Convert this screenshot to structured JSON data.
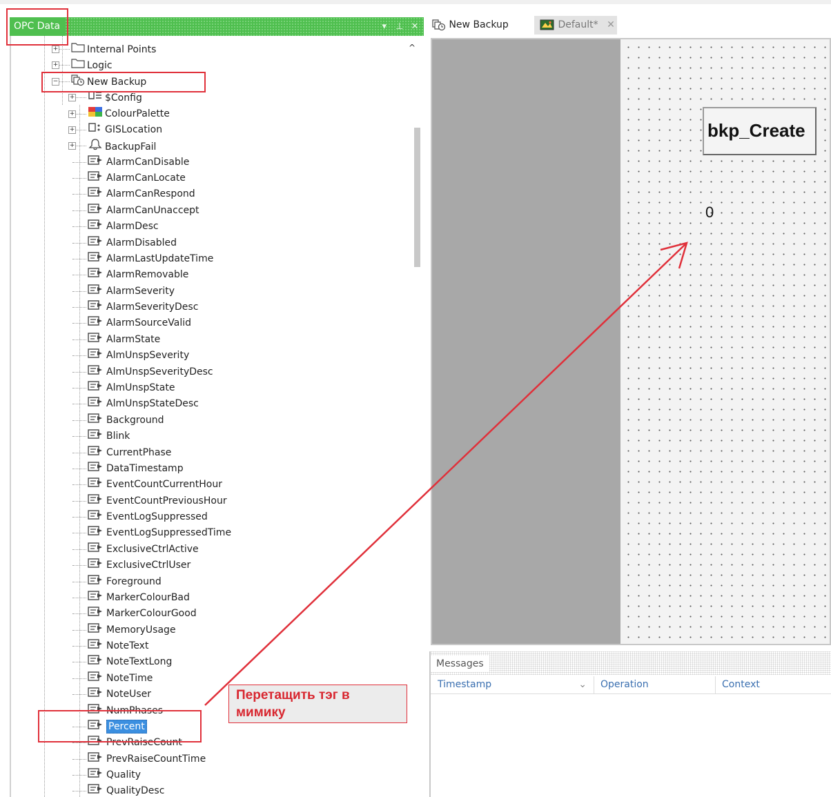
{
  "window": {
    "panel_title": "OPC Data",
    "panel_buttons": [
      "▾",
      "⊥",
      "✕"
    ]
  },
  "tree": {
    "roots": [
      {
        "label": "Internal Points",
        "icon": "folder-icon",
        "expander": "+"
      },
      {
        "label": "Logic",
        "icon": "folder-icon",
        "expander": "+"
      },
      {
        "label": "New Backup",
        "icon": "backup-icon",
        "expander": "−"
      }
    ],
    "groups": [
      {
        "label": "$Config",
        "icon": "config-icon",
        "expander": "+"
      },
      {
        "label": "ColourPalette",
        "icon": "palette-icon",
        "expander": "+"
      },
      {
        "label": "GISLocation",
        "icon": "location-icon",
        "expander": "+"
      },
      {
        "label": "BackupFail",
        "icon": "bell-icon",
        "expander": "+"
      }
    ],
    "tags": [
      "AlarmCanDisable",
      "AlarmCanLocate",
      "AlarmCanRespond",
      "AlarmCanUnaccept",
      "AlarmDesc",
      "AlarmDisabled",
      "AlarmLastUpdateTime",
      "AlarmRemovable",
      "AlarmSeverity",
      "AlarmSeverityDesc",
      "AlarmSourceValid",
      "AlarmState",
      "AlmUnspSeverity",
      "AlmUnspSeverityDesc",
      "AlmUnspState",
      "AlmUnspStateDesc",
      "Background",
      "Blink",
      "CurrentPhase",
      "DataTimestamp",
      "EventCountCurrentHour",
      "EventCountPreviousHour",
      "EventLogSuppressed",
      "EventLogSuppressedTime",
      "ExclusiveCtrlActive",
      "ExclusiveCtrlUser",
      "Foreground",
      "MarkerColourBad",
      "MarkerColourGood",
      "MemoryUsage",
      "NoteText",
      "NoteTextLong",
      "NoteTime",
      "NoteUser",
      "NumPhases",
      "Percent",
      "PrevRaiseCount",
      "PrevRaiseCountTime",
      "Quality",
      "QualityDesc"
    ],
    "selected_tag": "Percent",
    "tag_icon": "tag-icon"
  },
  "tabs": [
    {
      "label": "New Backup",
      "icon": "backup-icon",
      "active": true
    },
    {
      "label": "Default*",
      "icon": "mimic-icon",
      "active": false,
      "close": "✕"
    }
  ],
  "canvas": {
    "button_label": "bkp_Create",
    "value_text": "0"
  },
  "messages": {
    "title": "Messages",
    "columns": [
      "Timestamp",
      "Operation",
      "Context"
    ],
    "sort_indicator": "⌄"
  },
  "annotation": {
    "note": "Перетащить тэг в мимику",
    "color": "#e0303a"
  },
  "colors": {
    "panel_header": "#4fbf4f",
    "selection": "#3b8fe0",
    "canvas_margin": "#a8a8a8"
  }
}
